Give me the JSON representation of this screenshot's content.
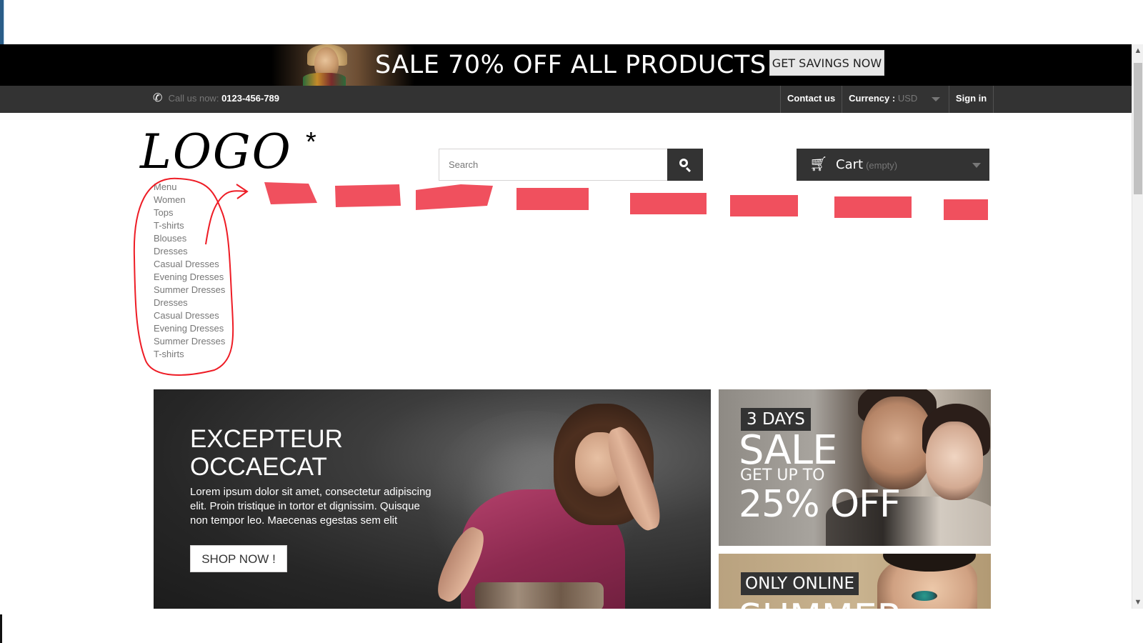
{
  "promo_banner": {
    "headline": "SALE 70% OFF ALL PRODUCTS",
    "cta_label": "GET SAVINGS NOW"
  },
  "nav": {
    "call_label": "Call us now:",
    "phone": "0123-456-789",
    "contact_label": "Contact us",
    "currency_label": "Currency :",
    "currency_value": "USD",
    "signin_label": "Sign in"
  },
  "header": {
    "logo_text": "LOGO",
    "logo_mark": "*",
    "search_placeholder": "Search",
    "cart_label": "Cart",
    "cart_state": "(empty)"
  },
  "menu": {
    "items": [
      "Menu",
      "Women",
      "Tops",
      "T-shirts",
      "Blouses",
      "Dresses",
      "Casual Dresses",
      "Evening Dresses",
      "Summer Dresses",
      "Dresses",
      "Casual Dresses",
      "Evening Dresses",
      "Summer Dresses",
      "T-shirts"
    ]
  },
  "annotation": {
    "color": "#ee1c25",
    "fill_color": "#f0505e"
  },
  "hero": {
    "title_line1": "EXCEPTEUR",
    "title_line2": "OCCAECAT",
    "description": "Lorem ipsum dolor sit amet, consectetur adipiscing elit. Proin tristique in tortor et dignissim. Quisque non tempor leo. Maecenas egestas sem elit",
    "button_label": "SHOP NOW !"
  },
  "side_banner_1": {
    "tag": "3 DAYS",
    "line1": "SALE",
    "line2": "GET UP TO",
    "line3": "25% OFF"
  },
  "side_banner_2": {
    "tag": "ONLY ONLINE",
    "line1": "SUMMER"
  },
  "colors": {
    "dark_bar": "#333333",
    "muted_text": "#777777",
    "banner_bg": "#000000"
  }
}
